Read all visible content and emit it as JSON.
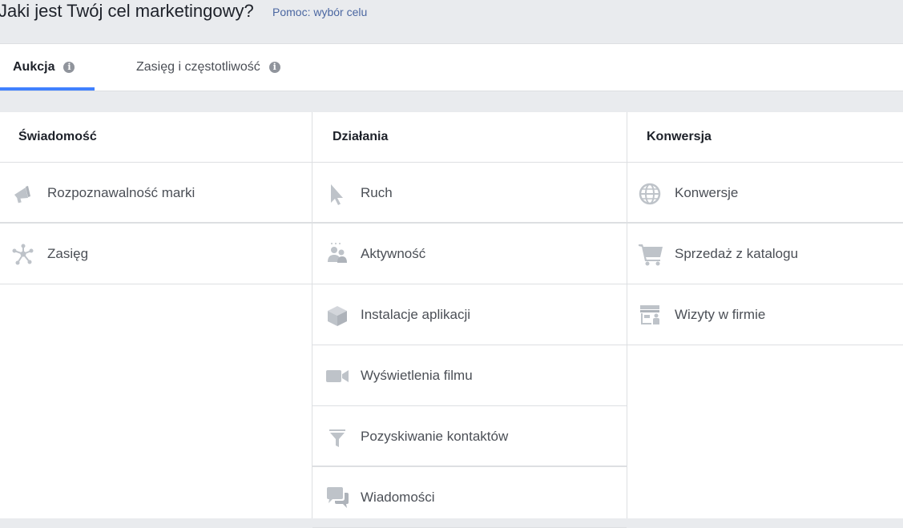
{
  "header": {
    "title": "Jaki jest Twój cel marketingowy?",
    "help_link": "Pomoc: wybór celu"
  },
  "tabs": [
    {
      "label": "Aukcja",
      "active": true
    },
    {
      "label": "Zasięg i częstotliwość",
      "active": false
    }
  ],
  "info_glyph": "i",
  "columns": [
    {
      "heading": "Świadomość",
      "items": [
        {
          "label": "Rozpoznawalność marki",
          "icon": "megaphone-icon"
        },
        {
          "label": "Zasięg",
          "icon": "reach-network-icon"
        }
      ]
    },
    {
      "heading": "Działania",
      "items": [
        {
          "label": "Ruch",
          "icon": "cursor-icon"
        },
        {
          "label": "Aktywność",
          "icon": "people-icon"
        },
        {
          "label": "Instalacje aplikacji",
          "icon": "cube-icon"
        },
        {
          "label": "Wyświetlenia filmu",
          "icon": "video-camera-icon"
        },
        {
          "label": "Pozyskiwanie kontaktów",
          "icon": "funnel-icon"
        },
        {
          "label": "Wiadomości",
          "icon": "chat-bubbles-icon"
        }
      ]
    },
    {
      "heading": "Konwersja",
      "items": [
        {
          "label": "Konwersje",
          "icon": "globe-icon"
        },
        {
          "label": "Sprzedaż z katalogu",
          "icon": "shopping-cart-icon"
        },
        {
          "label": "Wizyty w firmie",
          "icon": "store-icon"
        }
      ]
    }
  ],
  "colors": {
    "accent": "#4080ff",
    "link": "#4b67a1",
    "icon": "#bec3c9",
    "text": "#4b4f56"
  }
}
